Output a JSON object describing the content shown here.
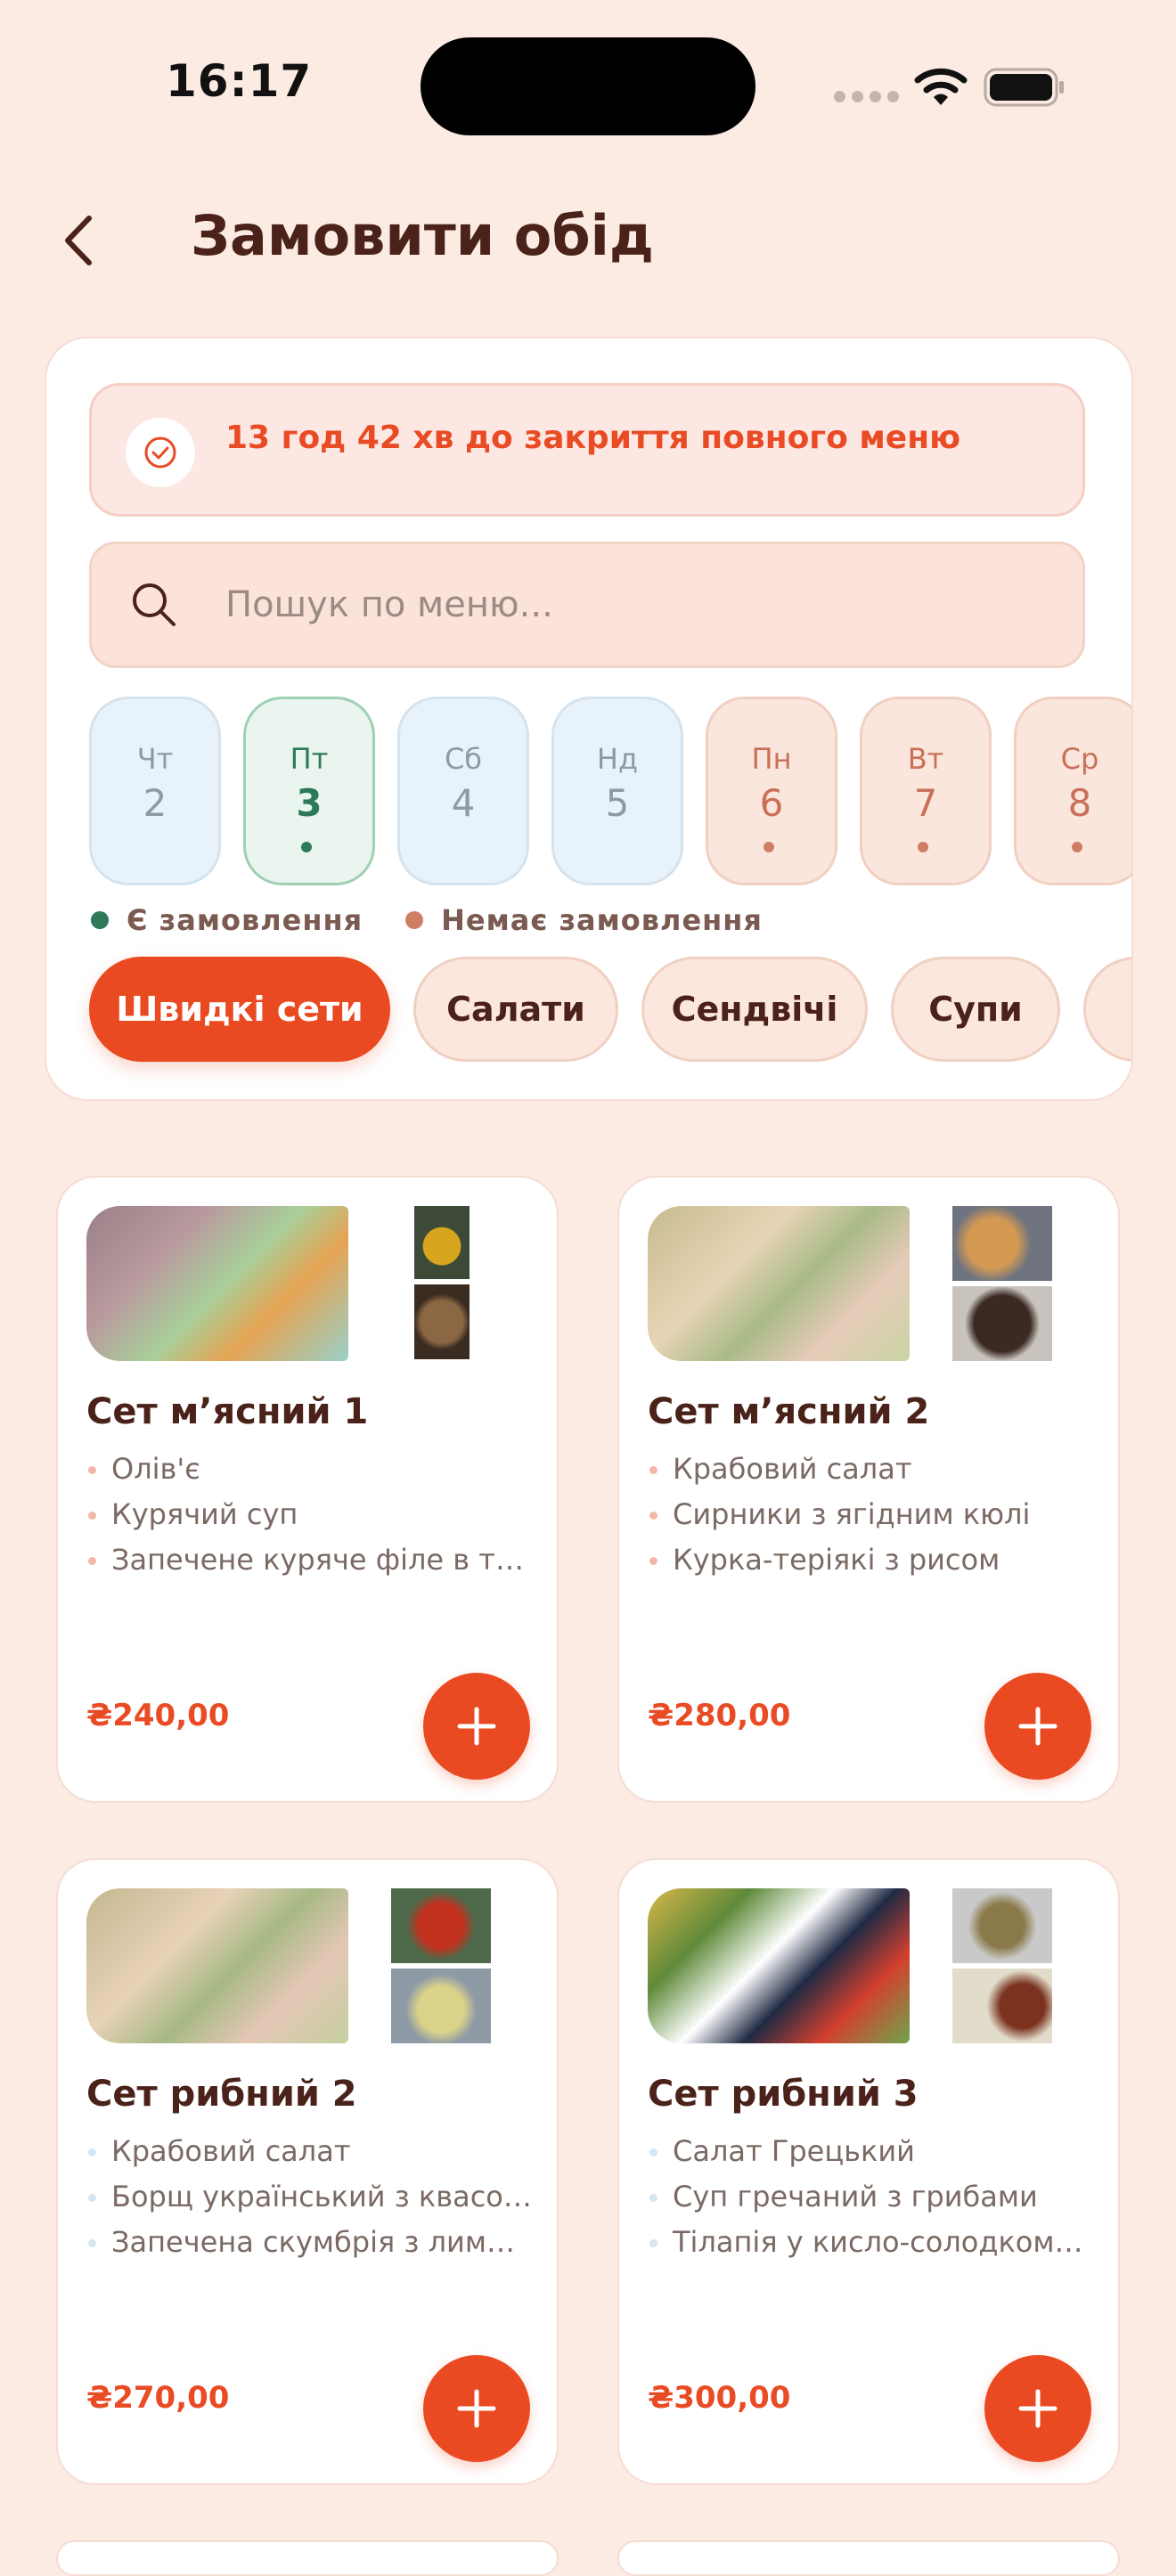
{
  "status_bar": {
    "time": "16:17"
  },
  "header": {
    "title": "Замовити обід",
    "back_icon": "chevron-left-icon"
  },
  "timer": {
    "text": "13 год 42 хв до закриття повного меню",
    "icon": "check-circle-icon"
  },
  "search": {
    "placeholder": "Пошук по меню...",
    "value": ""
  },
  "days": [
    {
      "weekday": "Чт",
      "day": "2",
      "state": "past"
    },
    {
      "weekday": "Пт",
      "day": "3",
      "state": "selected",
      "has_order": true
    },
    {
      "weekday": "Сб",
      "day": "4",
      "state": "past"
    },
    {
      "weekday": "Нд",
      "day": "5",
      "state": "past"
    },
    {
      "weekday": "Пн",
      "day": "6",
      "state": "future",
      "has_order": false
    },
    {
      "weekday": "Вт",
      "day": "7",
      "state": "future",
      "has_order": false
    },
    {
      "weekday": "Ср",
      "day": "8",
      "state": "future",
      "has_order": false
    }
  ],
  "legend": {
    "has_order": "Є замовлення",
    "no_order": "Немає замовлення",
    "has_order_color": "#2d7a58",
    "no_order_color": "#cf7e66"
  },
  "categories": [
    {
      "label": "Швидкі сети",
      "active": true
    },
    {
      "label": "Салати",
      "active": false
    },
    {
      "label": "Сендвічі",
      "active": false
    },
    {
      "label": "Супи",
      "active": false
    }
  ],
  "products": [
    {
      "title": "Сет м’ясний 1",
      "items": [
        "Олів'є",
        "Курячий суп",
        "Запечене куряче філе в томатному соусі"
      ],
      "price": "₴240,00"
    },
    {
      "title": "Сет м’ясний 2",
      "items": [
        "Крабовий салат",
        "Сирники з ягідним кюлі",
        "Курка-теріякі з рисом"
      ],
      "price": "₴280,00"
    },
    {
      "title": "Сет рибний 2",
      "items": [
        "Крабовий салат",
        "Борщ український з квасолею",
        "Запечена скумбрія з лимоном"
      ],
      "price": "₴270,00"
    },
    {
      "title": "Сет рибний 3",
      "items": [
        "Салат Грецький",
        "Суп гречаний з грибами",
        "Тілапія у кисло-солодкому соусі"
      ],
      "price": "₴300,00"
    }
  ],
  "colors": {
    "accent": "#ea4a21",
    "background": "#fcebe3",
    "text": "#4a2219"
  }
}
